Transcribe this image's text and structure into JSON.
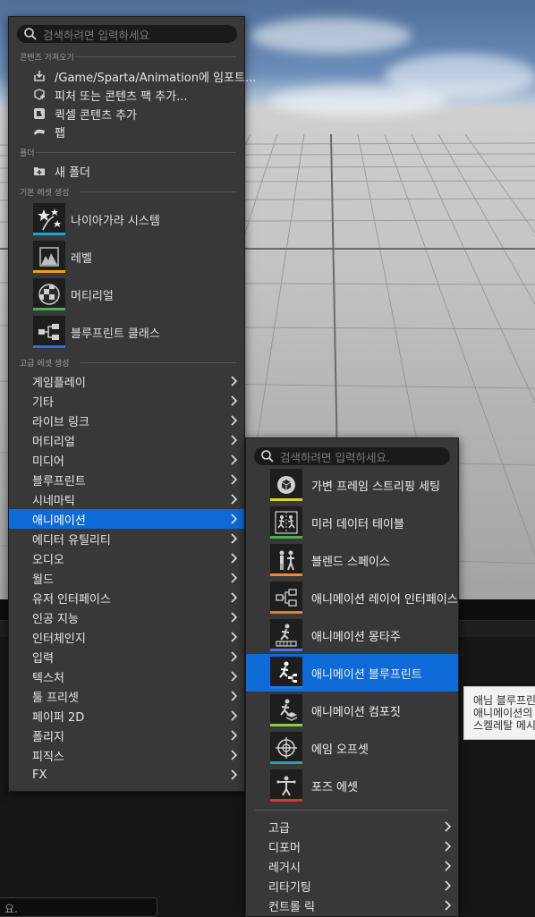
{
  "left_menu": {
    "search_placeholder": "검색하려면 입력하세요",
    "sections": {
      "import_content": "콘텐츠 가져오기",
      "folder": "폴더",
      "basic_assets": "기본 에셋 생성",
      "advanced_assets": "고급 에셋 생성"
    },
    "import_items": [
      {
        "label": "/Game/Sparta/Animation에 임포트...",
        "icon": "import-icon"
      },
      {
        "label": "피처 또는 콘텐츠 팩 추가...",
        "icon": "content-pack-icon"
      },
      {
        "label": "퀵셀 콘텐츠 추가",
        "icon": "quixel-icon"
      },
      {
        "label": "팹",
        "icon": "fab-icon"
      }
    ],
    "folder_items": [
      {
        "label": "새 폴더",
        "icon": "new-folder-icon"
      }
    ],
    "basic_items": [
      {
        "label": "나이아가라 시스템",
        "icon": "niagara-icon",
        "color": "#19a7d8"
      },
      {
        "label": "레벨",
        "icon": "level-icon",
        "color": "#f39c12"
      },
      {
        "label": "머티리얼",
        "icon": "material-icon",
        "color": "#4caf50"
      },
      {
        "label": "블루프린트 클래스",
        "icon": "blueprint-icon",
        "color": "#2f6fd9"
      }
    ],
    "categories": [
      "게임플레이",
      "기타",
      "라이브 링크",
      "머티리얼",
      "미디어",
      "블루프린트",
      "시네마틱",
      "애니메이션",
      "에디터 유틸리티",
      "오디오",
      "월드",
      "유저 인터페이스",
      "인공 지능",
      "인터체인지",
      "입력",
      "텍스처",
      "툴 프리셋",
      "페이퍼 2D",
      "폴리지",
      "피직스",
      "FX"
    ],
    "selected_category": "애니메이션"
  },
  "right_menu": {
    "search_placeholder": "검색하려면 입력하세요.",
    "assets": [
      {
        "label": "가변 프레임 스트리핑 세팅",
        "icon": "variable-frame-strip-icon",
        "color": "#e0d020"
      },
      {
        "label": "미러 데이터 테이블",
        "icon": "mirror-data-table-icon",
        "color": "#4caf50"
      },
      {
        "label": "블렌드 스페이스",
        "icon": "blend-space-icon",
        "color": "#f08a3a"
      },
      {
        "label": "애니메이션 레이어 인터페이스",
        "icon": "anim-layer-interface-icon",
        "color": "#e0802a"
      },
      {
        "label": "애니메이션 몽타주",
        "icon": "anim-montage-icon",
        "color": "#5a6ee0"
      },
      {
        "label": "애니메이션 블루프린트",
        "icon": "anim-blueprint-icon",
        "color": "#1e7ee0"
      },
      {
        "label": "애니메이션 컴포짓",
        "icon": "anim-composite-icon",
        "color": "#8ad03a"
      },
      {
        "label": "에임 오프셋",
        "icon": "aim-offset-icon",
        "color": "#2aa0c0"
      },
      {
        "label": "포즈 에셋",
        "icon": "pose-asset-icon",
        "color": "#d23a3a"
      }
    ],
    "selected_asset": "애니메이션 블루프린트",
    "subcategories": [
      "고급",
      "디포머",
      "레거시",
      "리타기팅",
      "컨트롤 릭"
    ]
  },
  "tooltip": {
    "lines": [
      "애님 블루프린",
      "애니메이션의 ",
      "스켈레탈 메시"
    ]
  },
  "console": {
    "text": "요."
  }
}
